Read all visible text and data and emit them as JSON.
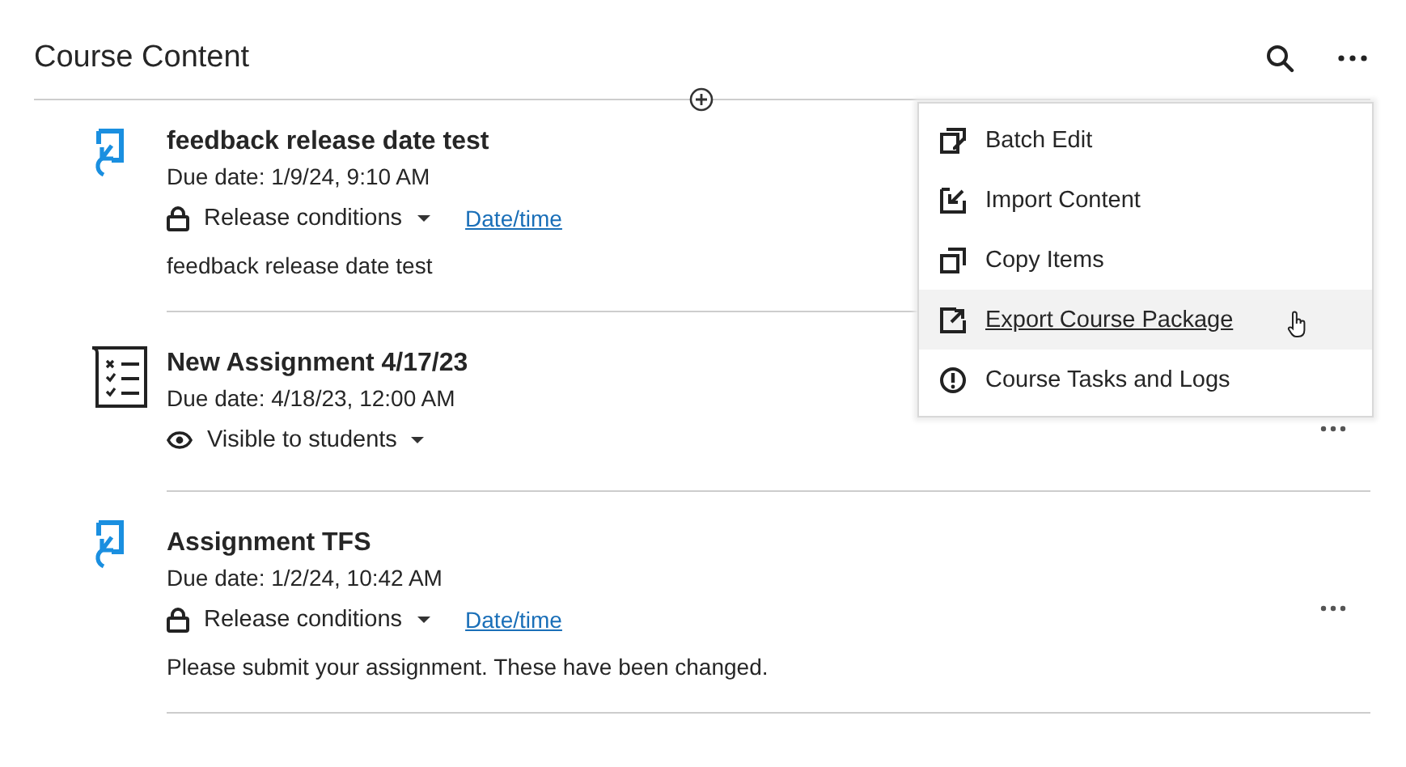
{
  "header": {
    "title": "Course Content"
  },
  "items": [
    {
      "kind": "linked",
      "title": "feedback release date test",
      "due": "Due date: 1/9/24, 9:10 AM",
      "status": {
        "kind": "release",
        "label": "Release conditions",
        "link": "Date/time"
      },
      "description": "feedback release date test",
      "has_menu": false
    },
    {
      "kind": "assignment",
      "title": "New Assignment 4/17/23",
      "due": "Due date: 4/18/23, 12:00 AM",
      "status": {
        "kind": "visibility",
        "label": "Visible to students"
      },
      "has_menu": true
    },
    {
      "kind": "linked",
      "title": "Assignment TFS",
      "due": "Due date: 1/2/24, 10:42 AM",
      "status": {
        "kind": "release",
        "label": "Release conditions",
        "link": "Date/time"
      },
      "description": "Please submit your assignment. These have been changed.",
      "has_menu": true
    }
  ],
  "menu": [
    {
      "label": "Batch Edit",
      "highlighted": false
    },
    {
      "label": "Import Content",
      "highlighted": false
    },
    {
      "label": "Copy Items",
      "highlighted": false
    },
    {
      "label": "Export Course Package",
      "highlighted": true
    },
    {
      "label": "Course Tasks and Logs",
      "highlighted": false
    }
  ]
}
